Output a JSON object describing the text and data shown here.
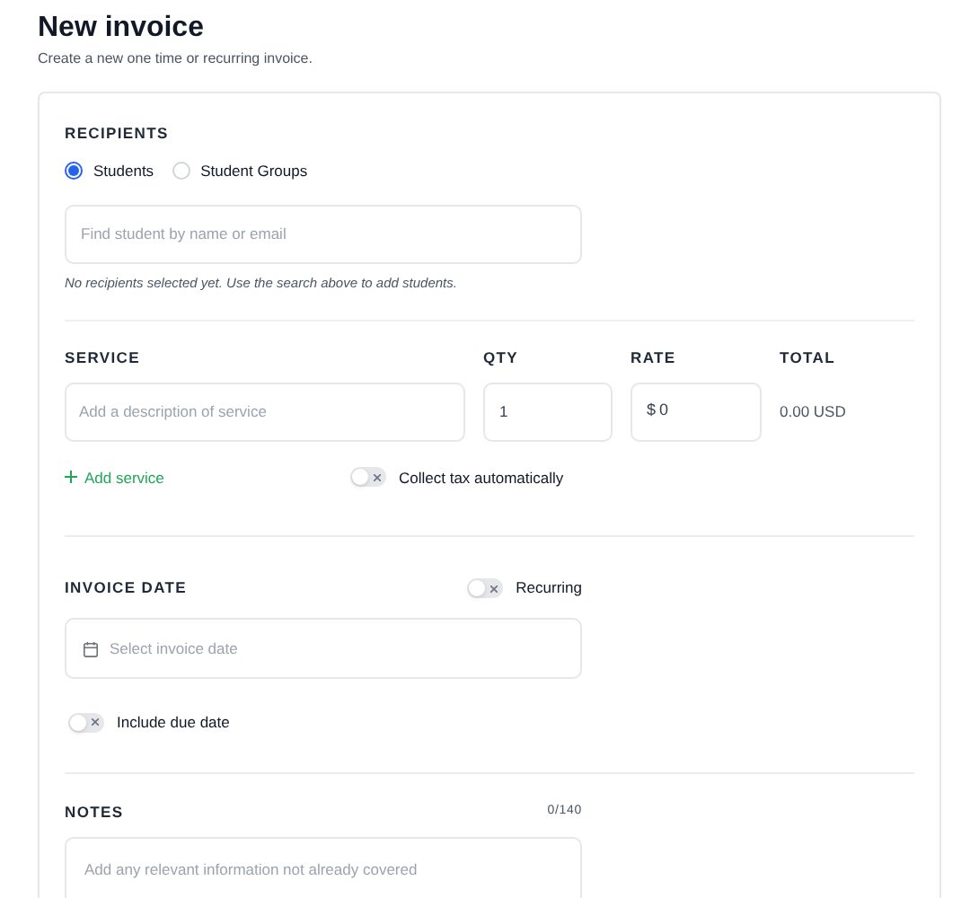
{
  "header": {
    "title": "New invoice",
    "subtitle": "Create a new one time or recurring invoice."
  },
  "recipients": {
    "label": "RECIPIENTS",
    "options": [
      {
        "label": "Students",
        "selected": true
      },
      {
        "label": "Student Groups",
        "selected": false
      }
    ],
    "search": {
      "placeholder": "Find student by name or email"
    },
    "hint": "No recipients selected yet. Use the search above to add students."
  },
  "service": {
    "columns": [
      "SERVICE",
      "QTY",
      "RATE",
      "TOTAL"
    ],
    "description": {
      "placeholder": "Add a description of service"
    },
    "qty": "1",
    "rate_prefix": "$",
    "rate": "0",
    "total": "0.00 USD",
    "add_label": "Add service",
    "tax": {
      "label": "Collect tax automatically",
      "on": false
    }
  },
  "invoice_date": {
    "label": "INVOICE DATE",
    "recurring": {
      "label": "Recurring",
      "on": false
    },
    "date": {
      "placeholder": "Select invoice date"
    },
    "due_date": {
      "label": "Include due date",
      "on": false
    }
  },
  "notes": {
    "label": "NOTES",
    "counter": "0/140",
    "field": {
      "placeholder": "Add any relevant information not already covered"
    }
  }
}
